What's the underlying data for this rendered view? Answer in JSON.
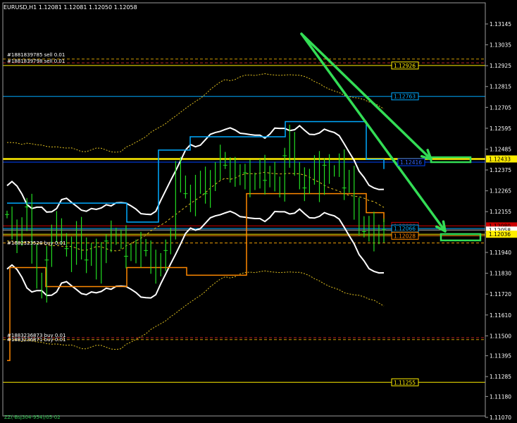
{
  "header": {
    "symbol_line": "EURUSD,H1  1.12081 1.12081 1.12050 1.12058"
  },
  "footer": {
    "zz_label": "ZZ(-Bsj304-954)/05-02"
  },
  "colors": {
    "background": "#000000",
    "candles": "#22dd22",
    "bands_inner": "#ffffff",
    "bands_outer": "#e0c020",
    "orange_channel": "#ff8800",
    "blue_channel": "#00aaff",
    "yellow_level": "#ffee00",
    "arrows": "#33dd55"
  },
  "orders": [
    {
      "label": "#1881839785 sell 0.01"
    },
    {
      "label": "#1881839798 sell 0.01"
    },
    {
      "label": "#1882323528 buy 0.01"
    },
    {
      "label": "#1883236873 buy 0.01"
    },
    {
      "label": "#1883236871 buy 0.01"
    }
  ],
  "chart_data": {
    "type": "candlestick",
    "title": "EURUSD,H1",
    "ylim": [
      1.1107,
      1.1321
    ],
    "y_ticks": [
      "1.13145",
      "1.13035",
      "1.12925",
      "1.12815",
      "1.12705",
      "1.12595",
      "1.12485",
      "1.12375",
      "1.12265",
      "1.12155",
      "1.12045",
      "1.11940",
      "1.11830",
      "1.11720",
      "1.11610",
      "1.11500",
      "1.11395",
      "1.11285",
      "1.11180",
      "1.11070"
    ],
    "price_levels": [
      {
        "value": 1.12926,
        "label": "1.12926",
        "color": "#ffee00"
      },
      {
        "value": 1.12763,
        "label": "1.12763",
        "color": "#00aaff"
      },
      {
        "value": 1.12433,
        "label": "1.12433",
        "color": "#ffee00"
      },
      {
        "value": 1.12416,
        "label": "1.12416",
        "color": "#0044ff"
      },
      {
        "value": 1.1208,
        "label": "1.12080",
        "color": "#cc0000"
      },
      {
        "value": 1.12066,
        "label": "1.12066",
        "color": "#00aaff"
      },
      {
        "value": 1.12058,
        "label": "1.12058",
        "color": "#c0c0c0"
      },
      {
        "value": 1.12036,
        "label": "1.12036",
        "color": "#ffee00"
      },
      {
        "value": 1.12028,
        "label": "1.12028",
        "color": "#ff8800"
      },
      {
        "value": 1.11255,
        "label": "1.11255",
        "color": "#ffee00"
      }
    ],
    "current_price": 1.12058,
    "close_path": [
      1.1214,
      1.1205,
      1.12,
      1.121,
      1.1218,
      1.1195,
      1.1178,
      1.1175,
      1.119,
      1.1205,
      1.121,
      1.12,
      1.1196,
      1.119,
      1.1208,
      1.1195,
      1.119,
      1.1196,
      1.1185,
      1.1192,
      1.12,
      1.1205,
      1.12,
      1.1202,
      1.1192,
      1.1196,
      1.1193,
      1.1198,
      1.1195,
      1.1188,
      1.1185,
      1.119,
      1.1195,
      1.1205,
      1.1238,
      1.1232,
      1.1225,
      1.122,
      1.1228,
      1.1234,
      1.1225,
      1.123,
      1.1238,
      1.1245,
      1.124,
      1.1235,
      1.1238,
      1.1232,
      1.1236,
      1.123,
      1.1233,
      1.1238,
      1.1232,
      1.1236,
      1.1232,
      1.1225,
      1.1245,
      1.1255,
      1.1237,
      1.1232,
      1.1228,
      1.1235,
      1.124,
      1.1228,
      1.124,
      1.1236,
      1.1238,
      1.1242,
      1.1228,
      1.1235,
      1.1216,
      1.121,
      1.1205,
      1.1208,
      1.1202,
      1.1205,
      1.1206
    ]
  }
}
